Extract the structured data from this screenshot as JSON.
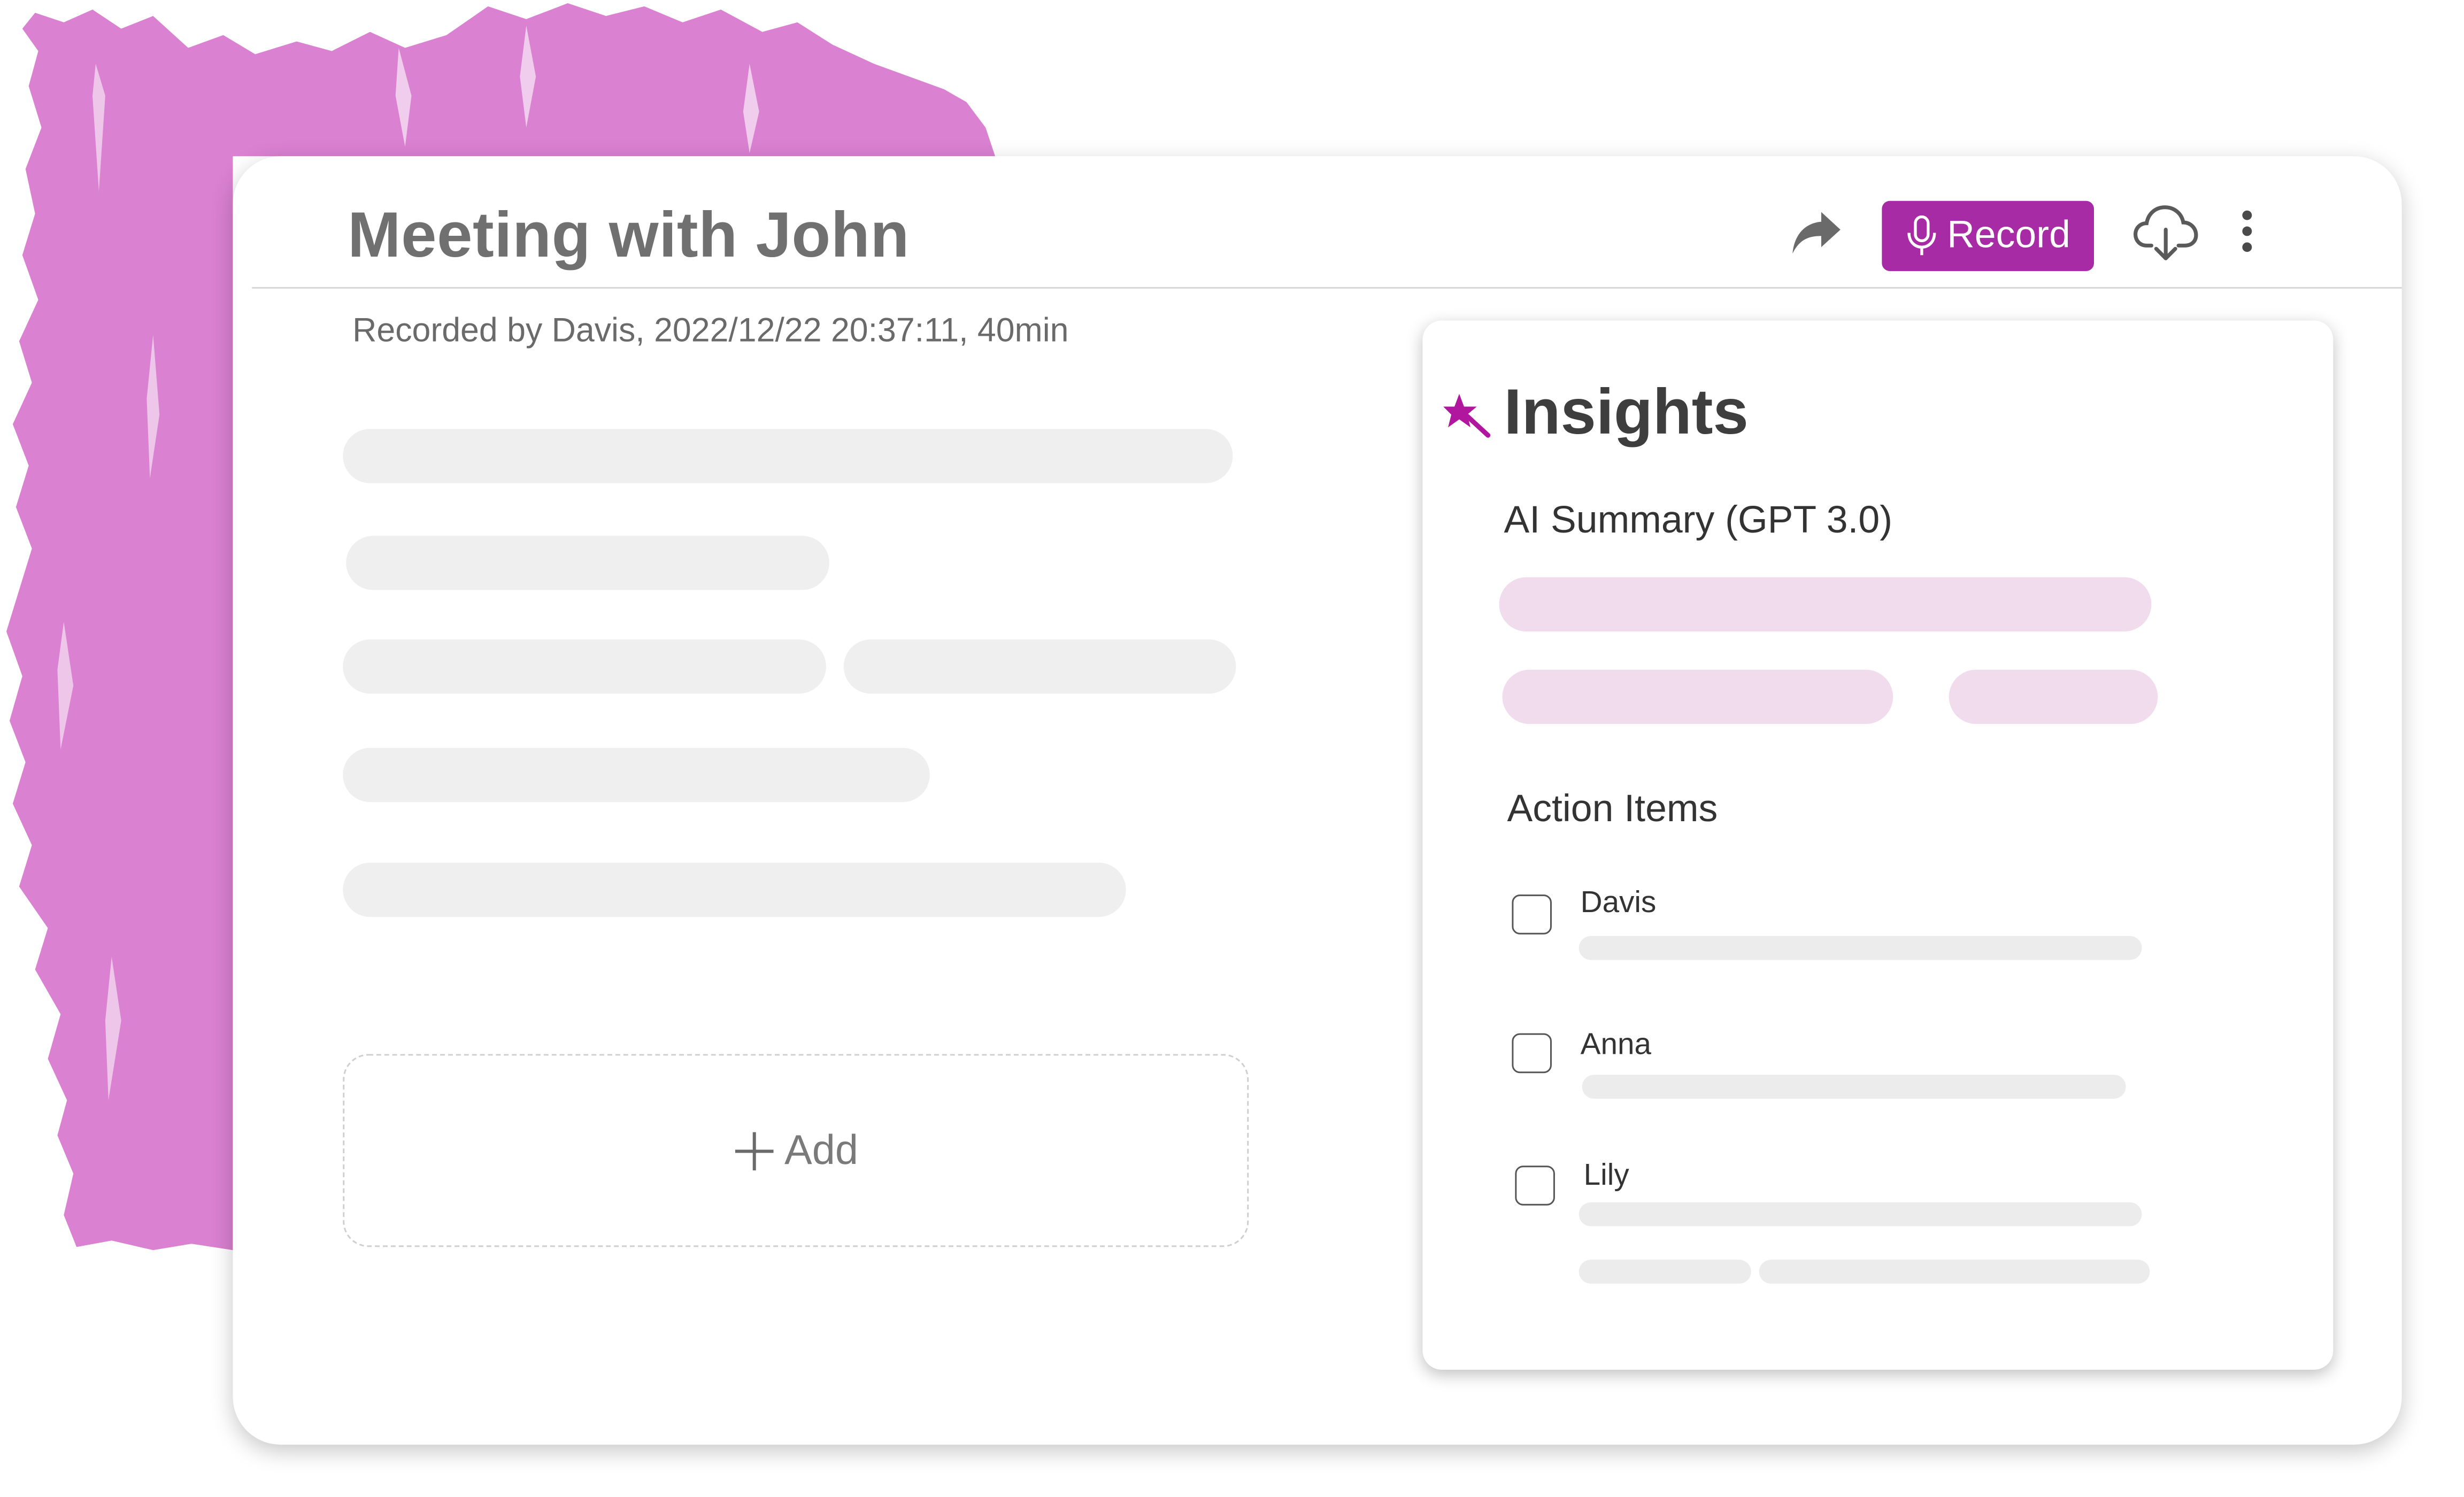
{
  "colors": {
    "accent": "#a72ba5",
    "brush": "#da81d1",
    "summary_placeholder": "#f1dcee",
    "placeholder": "#efefef"
  },
  "meeting": {
    "title": "Meeting with John",
    "subtitle": "Recorded by Davis, 2022/12/22  20:37:11, 40min"
  },
  "toolbar": {
    "share_icon": "share-arrow-icon",
    "record_label": "Record",
    "record_icon": "microphone-icon",
    "download_icon": "cloud-download-icon",
    "more_icon": "vertical-dots-icon"
  },
  "notes": {
    "add_label": "Add",
    "add_icon": "plus-icon"
  },
  "insights": {
    "title": "Insights",
    "title_icon": "magic-wand-star-icon",
    "summary_heading": "AI Summary (GPT 3.0)",
    "action_items_heading": "Action Items",
    "action_items": [
      {
        "assignee": "Davis",
        "checked": false
      },
      {
        "assignee": "Anna",
        "checked": false
      },
      {
        "assignee": "Lily",
        "checked": false
      }
    ]
  }
}
